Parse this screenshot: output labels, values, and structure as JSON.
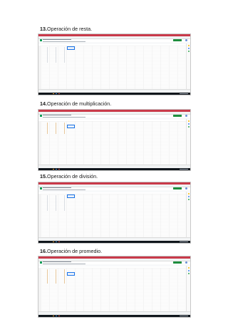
{
  "sections": [
    {
      "number": "13.",
      "title": "Operación de resta."
    },
    {
      "number": "14.",
      "title": "Operación de multiplicación."
    },
    {
      "number": "15.",
      "title": "Operación de división."
    },
    {
      "number": "16.",
      "title": "Operación de promedio."
    }
  ],
  "colors": {
    "tab_bar": "#c93a4a",
    "share_button": "#1e8e3e",
    "selection": "#1a73e8",
    "taskbar": "#10161c"
  }
}
